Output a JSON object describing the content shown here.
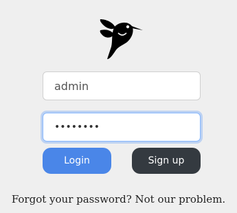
{
  "logo": {
    "icon": "hummingbird-icon",
    "color": "#000000"
  },
  "form": {
    "username": {
      "value": "admin"
    },
    "password": {
      "value": "password"
    }
  },
  "buttons": {
    "login_label": "Login",
    "signup_label": "Sign up"
  },
  "footer": {
    "forgot_text": "Forgot your password? Not our problem."
  },
  "colors": {
    "login_button": "#4a86e8",
    "signup_button": "#343a40",
    "background": "#efefef"
  }
}
